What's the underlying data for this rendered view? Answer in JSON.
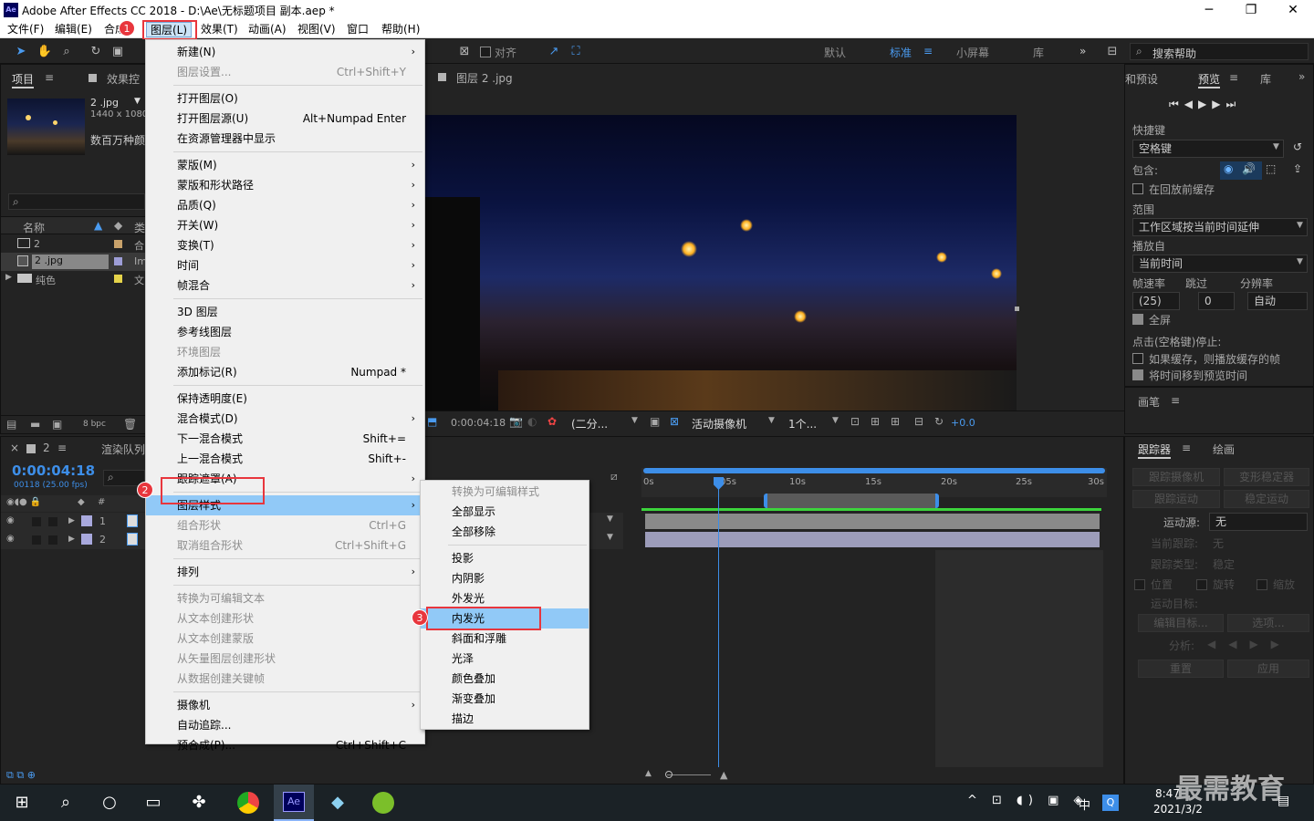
{
  "window": {
    "title": "Adobe After Effects CC 2018 - D:\\Ae\\无标题项目 副本.aep *",
    "logo": "Ae",
    "controls": [
      "─",
      "❐",
      "✕"
    ]
  },
  "menubar": [
    "文件(F)",
    "编辑(E)",
    "合成(C)",
    "图层(L)",
    "效果(T)",
    "动画(A)",
    "视图(V)",
    "窗口",
    "帮助(H)"
  ],
  "toolbar": {
    "snap_label": "对齐",
    "workspaces": [
      "默认",
      "标准",
      "小屏幕",
      "库"
    ],
    "search_placeholder": "搜索帮助",
    "more": "»"
  },
  "project_panel": {
    "tab": "项目",
    "tab2": "效果控",
    "item_name": "2 .jpg",
    "item_size": "1440 x 1080 (",
    "item_desc": "数百万种颜",
    "col_name": "名称",
    "col_type": "类",
    "rows": [
      {
        "name": "2",
        "type": "合"
      },
      {
        "name": "2 .jpg",
        "type": "Im"
      },
      {
        "name": "纯色",
        "type": "文"
      }
    ],
    "bpc": "8 bpc"
  },
  "viewer": {
    "tab": "图层 2 .jpg",
    "timecode": "0:00:04:18",
    "resolution": "(二分...",
    "camera": "活动摄像机",
    "views": "1个...",
    "exposure": "+0.0"
  },
  "timeline": {
    "tab": "2",
    "render_tab": "渲染队列",
    "timecode": "0:00:04:18",
    "fps": "00118 (25.00 fps)",
    "layers": [
      {
        "num": "1"
      },
      {
        "num": "2"
      }
    ],
    "ruler": [
      "0s",
      "05s",
      "10s",
      "15s",
      "20s",
      "25s",
      "30s"
    ]
  },
  "layer_menu": {
    "items": [
      {
        "label": "新建(N)",
        "shortcut": "",
        "arrow": true,
        "disabled": false
      },
      {
        "label": "图层设置...",
        "shortcut": "Ctrl+Shift+Y",
        "arrow": false,
        "disabled": true
      },
      {
        "label": "打开图层(O)",
        "shortcut": "",
        "arrow": false,
        "disabled": false
      },
      {
        "label": "打开图层源(U)",
        "shortcut": "Alt+Numpad Enter",
        "arrow": false,
        "disabled": false
      },
      {
        "label": "在资源管理器中显示",
        "shortcut": "",
        "arrow": false,
        "disabled": false
      },
      {
        "label": "蒙版(M)",
        "shortcut": "",
        "arrow": true,
        "disabled": false
      },
      {
        "label": "蒙版和形状路径",
        "shortcut": "",
        "arrow": true,
        "disabled": false
      },
      {
        "label": "品质(Q)",
        "shortcut": "",
        "arrow": true,
        "disabled": false
      },
      {
        "label": "开关(W)",
        "shortcut": "",
        "arrow": true,
        "disabled": false
      },
      {
        "label": "变换(T)",
        "shortcut": "",
        "arrow": true,
        "disabled": false
      },
      {
        "label": "时间",
        "shortcut": "",
        "arrow": true,
        "disabled": false
      },
      {
        "label": "帧混合",
        "shortcut": "",
        "arrow": true,
        "disabled": false
      },
      {
        "label": "3D 图层",
        "shortcut": "",
        "arrow": false,
        "disabled": false
      },
      {
        "label": "参考线图层",
        "shortcut": "",
        "arrow": false,
        "disabled": false
      },
      {
        "label": "环境图层",
        "shortcut": "",
        "arrow": false,
        "disabled": true
      },
      {
        "label": "添加标记(R)",
        "shortcut": "Numpad *",
        "arrow": false,
        "disabled": false
      },
      {
        "label": "保持透明度(E)",
        "shortcut": "",
        "arrow": false,
        "disabled": false
      },
      {
        "label": "混合模式(D)",
        "shortcut": "",
        "arrow": true,
        "disabled": false
      },
      {
        "label": "下一混合模式",
        "shortcut": "Shift+=",
        "arrow": false,
        "disabled": false
      },
      {
        "label": "上一混合模式",
        "shortcut": "Shift+-",
        "arrow": false,
        "disabled": false
      },
      {
        "label": "跟踪遮罩(A)",
        "shortcut": "",
        "arrow": true,
        "disabled": false
      },
      {
        "label": "图层样式",
        "shortcut": "",
        "arrow": true,
        "disabled": false
      },
      {
        "label": "组合形状",
        "shortcut": "Ctrl+G",
        "arrow": false,
        "disabled": true
      },
      {
        "label": "取消组合形状",
        "shortcut": "Ctrl+Shift+G",
        "arrow": false,
        "disabled": true
      },
      {
        "label": "排列",
        "shortcut": "",
        "arrow": true,
        "disabled": false
      },
      {
        "label": "转换为可编辑文本",
        "shortcut": "",
        "arrow": false,
        "disabled": true
      },
      {
        "label": "从文本创建形状",
        "shortcut": "",
        "arrow": false,
        "disabled": true
      },
      {
        "label": "从文本创建蒙版",
        "shortcut": "",
        "arrow": false,
        "disabled": true
      },
      {
        "label": "从矢量图层创建形状",
        "shortcut": "",
        "arrow": false,
        "disabled": true
      },
      {
        "label": "从数据创建关键帧",
        "shortcut": "",
        "arrow": false,
        "disabled": true
      },
      {
        "label": "摄像机",
        "shortcut": "",
        "arrow": true,
        "disabled": false
      },
      {
        "label": "自动追踪...",
        "shortcut": "",
        "arrow": false,
        "disabled": false
      },
      {
        "label": "预合成(P)...",
        "shortcut": "Ctrl+Shift+C",
        "arrow": false,
        "disabled": false
      }
    ]
  },
  "style_submenu": {
    "items": [
      {
        "label": "转换为可编辑样式",
        "disabled": true
      },
      {
        "label": "全部显示",
        "disabled": false
      },
      {
        "label": "全部移除",
        "disabled": false
      },
      {
        "label": "投影",
        "disabled": false
      },
      {
        "label": "内阴影",
        "disabled": false
      },
      {
        "label": "外发光",
        "disabled": false
      },
      {
        "label": "内发光",
        "disabled": false
      },
      {
        "label": "斜面和浮雕",
        "disabled": false
      },
      {
        "label": "光泽",
        "disabled": false
      },
      {
        "label": "颜色叠加",
        "disabled": false
      },
      {
        "label": "渐变叠加",
        "disabled": false
      },
      {
        "label": "描边",
        "disabled": false
      }
    ]
  },
  "badges": [
    "1",
    "2",
    "3"
  ],
  "preview_panel": {
    "tab1": "和预设",
    "tab2": "预览",
    "tab3": "库",
    "shortcut_label": "快捷键",
    "shortcut_value": "空格键",
    "include_label": "包含:",
    "cache_before": "在回放前缓存",
    "range_label": "范围",
    "range_value": "工作区域按当前时间延伸",
    "play_from_label": "播放自",
    "play_from_value": "当前时间",
    "fps_label": "帧速率",
    "skip_label": "跳过",
    "res_label": "分辨率",
    "fps_value": "(25)",
    "skip_value": "0",
    "res_value": "自动",
    "fullscreen": "全屏",
    "stop_label": "点击(空格键)停止:",
    "cache_if": "如果缓存，则播放缓存的帧",
    "move_time": "将时间移到预览时间"
  },
  "paint_panel": {
    "tab": "画笔"
  },
  "tracker_panel": {
    "tab1": "跟踪器",
    "tab2": "绘画",
    "btn_track_camera": "跟踪摄像机",
    "btn_warp": "变形稳定器",
    "btn_track_motion": "跟踪运动",
    "btn_stabilize": "稳定运动",
    "source_label": "运动源:",
    "source_value": "无",
    "current_label": "当前跟踪:",
    "current_value": "无",
    "type_label": "跟踪类型:",
    "type_value": "稳定",
    "pos": "位置",
    "rot": "旋转",
    "scale": "缩放",
    "target_label": "运动目标:",
    "edit_target": "编辑目标...",
    "options": "选项...",
    "analyze": "分析:",
    "reset": "重置",
    "apply": "应用"
  },
  "taskbar": {
    "time": "8:47",
    "date": "2021/3/2",
    "ime": "中"
  },
  "watermark": "最需教育"
}
